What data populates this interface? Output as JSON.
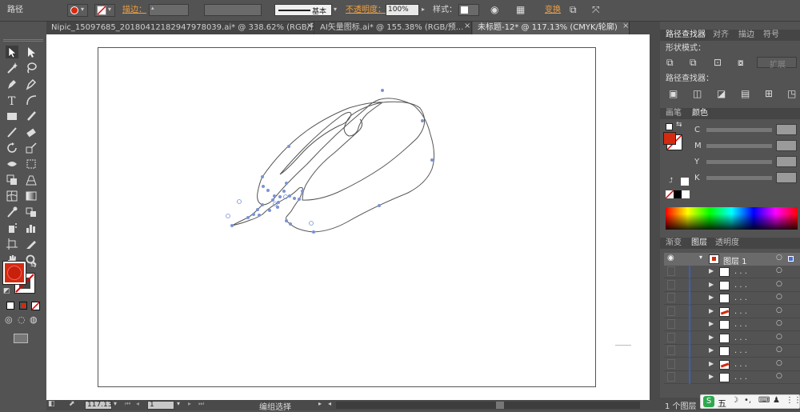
{
  "control_bar": {
    "title": "路径",
    "stroke_label": "描边：",
    "brush_label": "基本",
    "opacity_label": "不透明度：",
    "opacity_value": "100%",
    "style_label": "样式：",
    "transform_label": "变换"
  },
  "tabs": [
    {
      "label": "Nipic_15097685_20180412182947978039.ai* @ 338.62% (RGB/预..."
    },
    {
      "label": "AI矢量图标.ai* @ 155.38% (RGB/预..."
    },
    {
      "label": "未标题-12* @ 117.13% (CMYK/轮廓)"
    }
  ],
  "status": {
    "zoom": "117.13",
    "page": "1",
    "mode": "编组选择"
  },
  "pathfinder": {
    "tabs": [
      "路径查找器",
      "对齐",
      "描边",
      "符号"
    ],
    "shape_modes_label": "形状模式：",
    "expand_label": "扩展",
    "pathfinders_label": "路径查找器："
  },
  "color_panel": {
    "tabs": [
      "画笔",
      "颜色"
    ],
    "channels": [
      "C",
      "M",
      "Y",
      "K"
    ]
  },
  "layers_panel": {
    "tabs": [
      "渐变",
      "图层",
      "透明度"
    ],
    "layer_name": "图层 1",
    "sublayers": [
      ". . .",
      ". . .",
      ". . .",
      ". . .",
      ". . .",
      ". . .",
      ". . .",
      ". . .",
      ". . ."
    ],
    "footer_count": "1 个图层"
  },
  "taskbar": {
    "ime_label": "五"
  },
  "colors": {
    "fill": "#d42a10",
    "panel_bg": "#535353",
    "path_stroke": "#555555",
    "anchor": "#7b93d4"
  }
}
